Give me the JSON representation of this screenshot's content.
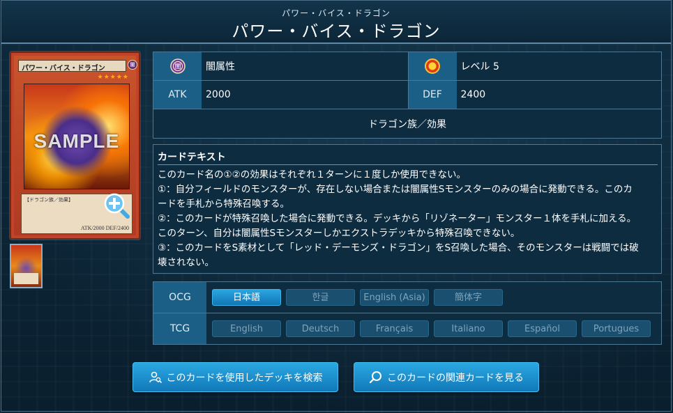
{
  "header": {
    "ruby": "パワー・バイス・ドラゴン",
    "title": "パワー・バイス・ドラゴン"
  },
  "card_image": {
    "name": "パワー・バイス・ドラゴン",
    "attribute_glyph": "闇",
    "level_stars": "★★★★★",
    "watermark": "SAMPLE",
    "type_line": "【ドラゴン族／効果】",
    "stats_line": "ATK/2000  DEF/2400"
  },
  "info": {
    "attribute": "闇属性",
    "level": "レベル 5",
    "atk_label": "ATK",
    "atk_value": "2000",
    "def_label": "DEF",
    "def_value": "2400",
    "type": "ドラゴン族／効果"
  },
  "card_text": {
    "heading": "カードテキスト",
    "lines": [
      "このカード名の①②の効果はそれぞれ１ターンに１度しか使用できない。",
      "①：自分フィールドのモンスターが、存在しない場合または闇属性Sモンスターのみの場合に発動できる。このカ",
      "ードを手札から特殊召喚する。",
      "②：このカードが特殊召喚した場合に発動できる。デッキから「リゾネーター」モンスター１体を手札に加える。",
      "このターン、自分は闇属性Sモンスターしかエクストラデッキから特殊召喚できない。",
      "③：このカードをS素材として「レッド・デーモンズ・ドラゴン」をS召喚した場合、そのモンスターは戦闘では破",
      "壊されない。"
    ]
  },
  "languages": {
    "ocg_label": "OCG",
    "tcg_label": "TCG",
    "ocg": [
      "日本語",
      "한글",
      "English (Asia)",
      "簡体字"
    ],
    "tcg": [
      "English",
      "Deutsch",
      "Français",
      "Italiano",
      "Español",
      "Portugues"
    ],
    "active": "日本語"
  },
  "buttons": {
    "deck_search": "このカードを使用したデッキを検索",
    "related_cards": "このカードの関連カードを見る"
  },
  "colors": {
    "accent": "#1b5f87",
    "button": "#1a8fd0",
    "background": "#0b2233"
  }
}
